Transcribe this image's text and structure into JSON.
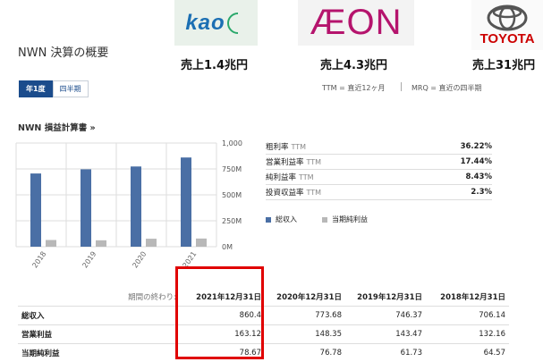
{
  "logos": {
    "kao": {
      "text": "kao",
      "color": "#1b6fb3"
    },
    "aeon": {
      "text": "ÆON",
      "color": "#b5146d"
    },
    "toyota": {
      "text": "TOYOTA",
      "color": "#cc0000"
    }
  },
  "sales_notes": [
    "売上1.4兆円",
    "売上4.3兆円",
    "売上31兆円"
  ],
  "page_title": "NWN 決算の概要",
  "tabs": [
    {
      "label": "年1度",
      "active": true
    },
    {
      "label": "四半期",
      "active": false
    }
  ],
  "ttm_note": "TTM = 直近12ヶ月",
  "mrq_note": "MRQ = 直近の四半期",
  "section_title": "NWN 損益計算書 »",
  "ratios": [
    {
      "label": "粗利率",
      "tag": "TTM",
      "value": "36.22%"
    },
    {
      "label": "営業利益率",
      "tag": "TTM",
      "value": "17.44%"
    },
    {
      "label": "純利益率",
      "tag": "TTM",
      "value": "8.43%"
    },
    {
      "label": "投資収益率",
      "tag": "TTM",
      "value": "2.3%"
    }
  ],
  "legend": [
    {
      "label": "総収入",
      "color": "#4a6fa5"
    },
    {
      "label": "当期純利益",
      "color": "#b8b8b8"
    }
  ],
  "chart_data": {
    "type": "bar",
    "categories": [
      "2018",
      "2019",
      "2020",
      "2021"
    ],
    "series": [
      {
        "name": "総収入",
        "values": [
          706.14,
          746.37,
          773.68,
          860.4
        ],
        "color": "#4a6fa5"
      },
      {
        "name": "当期純利益",
        "values": [
          64.57,
          61.73,
          76.78,
          78.67
        ],
        "color": "#b8b8b8"
      }
    ],
    "yticks": [
      "1,000",
      "750M",
      "500M",
      "250M",
      "0M"
    ],
    "ylim": [
      0,
      1000
    ],
    "grid": true
  },
  "table": {
    "period_label": "期間の終わり:",
    "columns": [
      "2021年12月31日",
      "2020年12月31日",
      "2019年12月31日",
      "2018年12月31日"
    ],
    "rows": [
      {
        "label": "総収入",
        "values": [
          "860.4",
          "773.68",
          "746.37",
          "706.14"
        ]
      },
      {
        "label": "営業利益",
        "values": [
          "163.12",
          "148.35",
          "143.47",
          "132.16"
        ]
      },
      {
        "label": "当期純利益",
        "values": [
          "78.67",
          "76.78",
          "61.73",
          "64.57"
        ]
      }
    ]
  }
}
